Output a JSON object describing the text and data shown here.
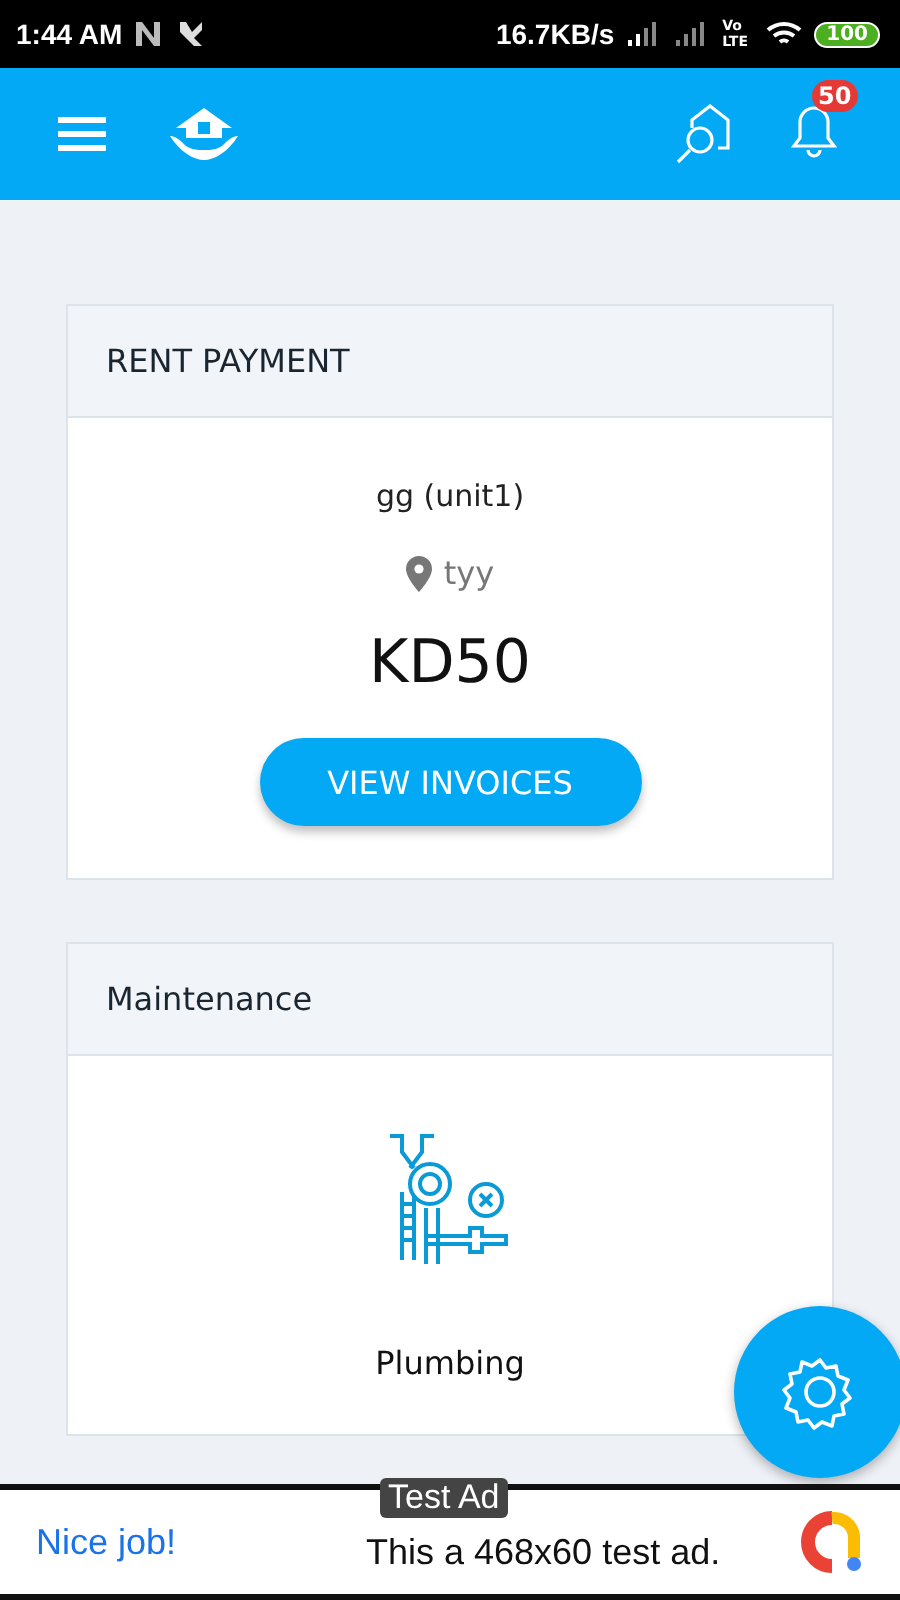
{
  "status_bar": {
    "time": "1:44 AM",
    "speed": "16.7KB/s",
    "network": "Vo LTE",
    "battery": "100"
  },
  "app_bar": {
    "notification_count": "50"
  },
  "rent_card": {
    "title": "RENT PAYMENT",
    "unit": "gg (unit1)",
    "location": "tyy",
    "amount": "KD50",
    "button": "VIEW INVOICES"
  },
  "maintenance_card": {
    "title": "Maintenance",
    "category": "Plumbing"
  },
  "ad": {
    "badge": "Test Ad",
    "headline": "Nice job!",
    "text": "This a 468x60 test ad."
  }
}
